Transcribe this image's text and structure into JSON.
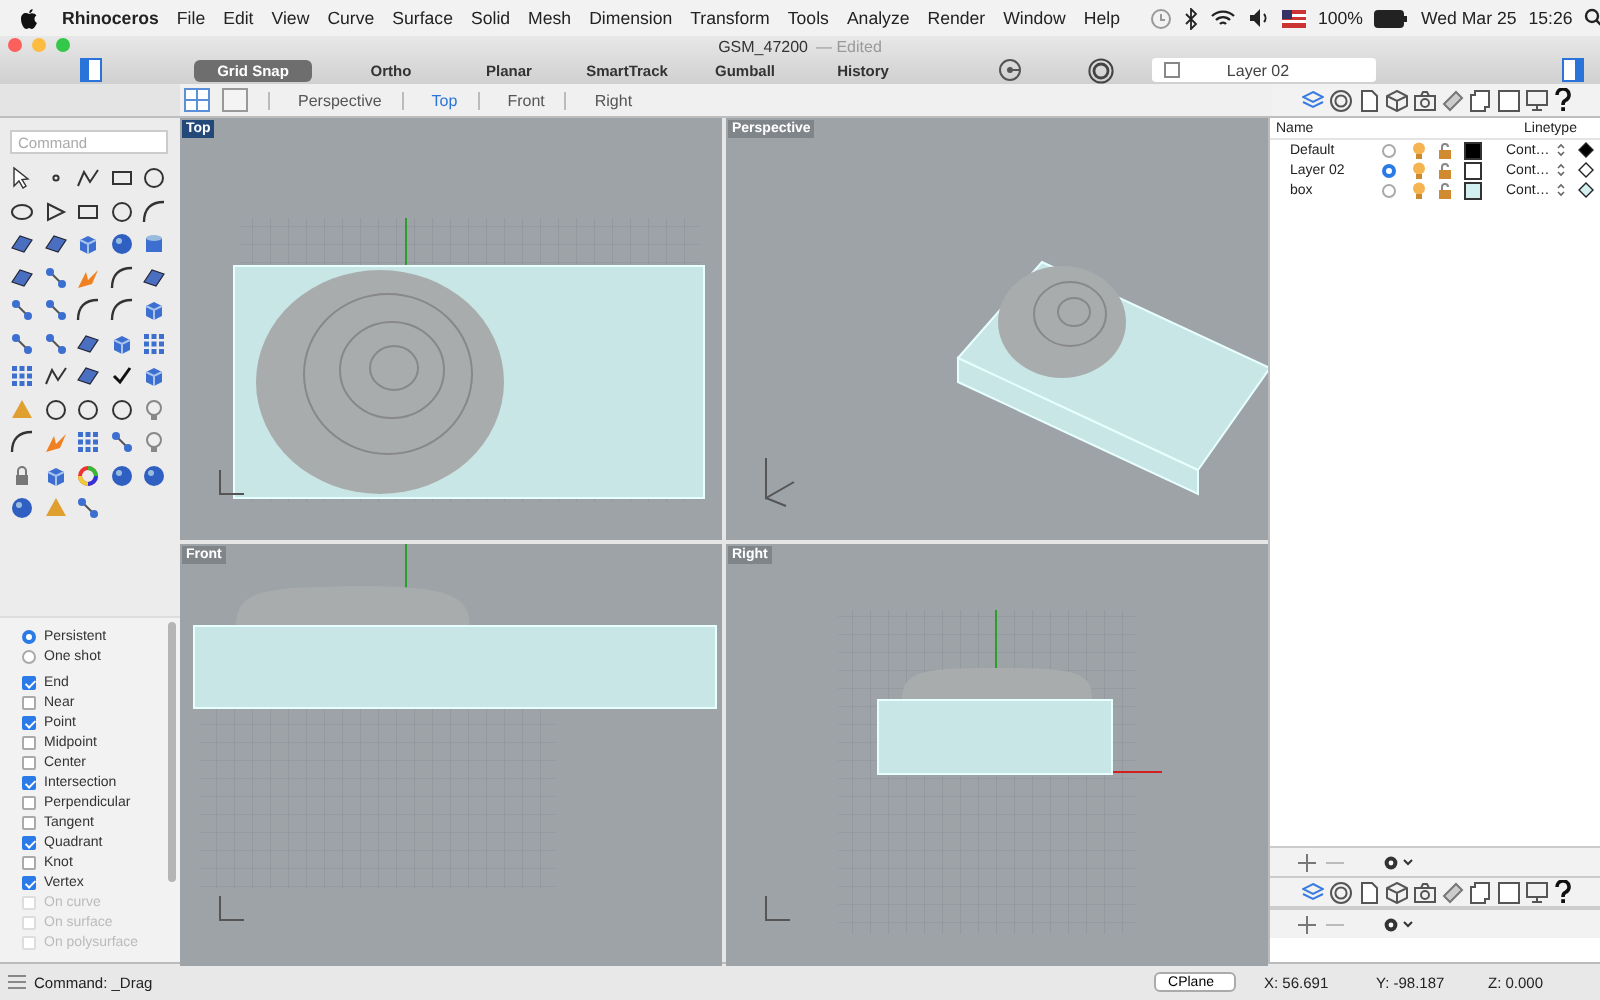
{
  "menu_bar": {
    "app": "Rhinoceros",
    "menus": [
      "File",
      "Edit",
      "View",
      "Curve",
      "Surface",
      "Solid",
      "Mesh",
      "Dimension",
      "Transform",
      "Tools",
      "Analyze",
      "Render",
      "Window",
      "Help"
    ],
    "battery": "100%",
    "date": "Wed Mar 25",
    "time": "15:26"
  },
  "window": {
    "title": "GSM_47200",
    "subtitle": "— Edited"
  },
  "toolbar": {
    "toggles": [
      {
        "label": "Grid Snap",
        "on": true
      },
      {
        "label": "Ortho",
        "on": false
      },
      {
        "label": "Planar",
        "on": false
      },
      {
        "label": "SmartTrack",
        "on": false
      },
      {
        "label": "Gumball",
        "on": false
      },
      {
        "label": "History",
        "on": false
      }
    ],
    "layer_picker": {
      "checked": false,
      "value": "Layer 02"
    }
  },
  "viewport_tabs": [
    {
      "label": "Perspective",
      "selected": false
    },
    {
      "label": "Top",
      "selected": true
    },
    {
      "label": "Front",
      "selected": false
    },
    {
      "label": "Right",
      "selected": false
    }
  ],
  "command": {
    "placeholder": "Command"
  },
  "osnaps": {
    "modes": [
      {
        "label": "Persistent",
        "selected": true
      },
      {
        "label": "One shot",
        "selected": false
      }
    ],
    "snaps": [
      {
        "label": "End",
        "checked": true,
        "disabled": false
      },
      {
        "label": "Near",
        "checked": false,
        "disabled": false
      },
      {
        "label": "Point",
        "checked": true,
        "disabled": false
      },
      {
        "label": "Midpoint",
        "checked": false,
        "disabled": false
      },
      {
        "label": "Center",
        "checked": false,
        "disabled": false
      },
      {
        "label": "Intersection",
        "checked": true,
        "disabled": false
      },
      {
        "label": "Perpendicular",
        "checked": false,
        "disabled": false
      },
      {
        "label": "Tangent",
        "checked": false,
        "disabled": false
      },
      {
        "label": "Quadrant",
        "checked": true,
        "disabled": false
      },
      {
        "label": "Knot",
        "checked": false,
        "disabled": false
      },
      {
        "label": "Vertex",
        "checked": true,
        "disabled": false
      },
      {
        "label": "On curve",
        "checked": false,
        "disabled": true
      },
      {
        "label": "On surface",
        "checked": false,
        "disabled": true
      },
      {
        "label": "On polysurface",
        "checked": false,
        "disabled": true
      }
    ]
  },
  "viewports": [
    {
      "label": "Top",
      "kind": "top",
      "selected": true
    },
    {
      "label": "Perspective",
      "kind": "perspective",
      "selected": false
    },
    {
      "label": "Front",
      "kind": "front",
      "selected": false
    },
    {
      "label": "Right",
      "kind": "right",
      "selected": false
    }
  ],
  "layers": {
    "columns": [
      "Name",
      "Linetype"
    ],
    "rows": [
      {
        "name": "Default",
        "selected": false,
        "color": "#000000",
        "linetype": "Cont…"
      },
      {
        "name": "Layer 02",
        "selected": true,
        "color": "#ffffff",
        "linetype": "Cont…"
      },
      {
        "name": "box",
        "selected": false,
        "color": "#d2f0f0",
        "linetype": "Cont…"
      }
    ]
  },
  "status_bar": {
    "command": "Command: _Drag",
    "cplane": "CPlane",
    "x": "X: 56.691",
    "y": "Y: -98.187",
    "z": "Z: 0.000"
  }
}
